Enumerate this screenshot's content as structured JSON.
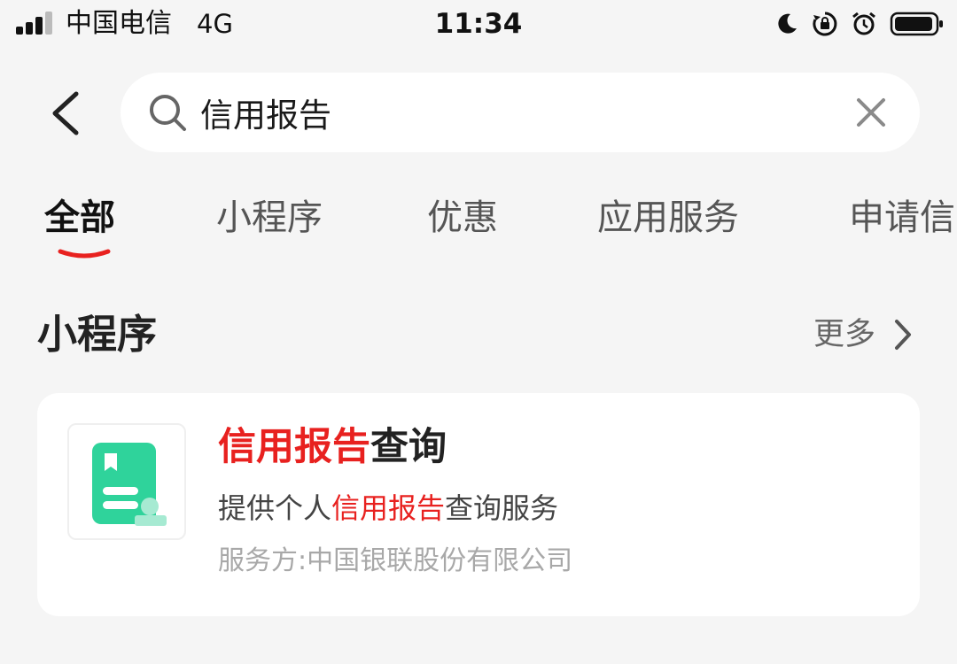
{
  "status_bar": {
    "carrier": "中国电信",
    "network": "4G",
    "time": "11:34",
    "icons": [
      "signal-icon",
      "moon-icon",
      "rotation-lock-icon",
      "alarm-icon",
      "battery-icon"
    ]
  },
  "search": {
    "query": "信用报告",
    "placeholder": ""
  },
  "tabs": [
    {
      "label": "全部",
      "active": true
    },
    {
      "label": "小程序",
      "active": false
    },
    {
      "label": "优惠",
      "active": false
    },
    {
      "label": "应用服务",
      "active": false
    },
    {
      "label": "申请信",
      "active": false
    }
  ],
  "section": {
    "title": "小程序",
    "more_label": "更多"
  },
  "result": {
    "title_highlight": "信用报告",
    "title_rest": "查询",
    "desc_prefix": "提供个人",
    "desc_highlight": "信用报告",
    "desc_suffix": "查询服务",
    "provider": "服务方:中国银联股份有限公司"
  },
  "colors": {
    "highlight": "#e8211f",
    "logo_green": "#2fd39b",
    "background": "#f5f5f5",
    "card": "#ffffff"
  }
}
